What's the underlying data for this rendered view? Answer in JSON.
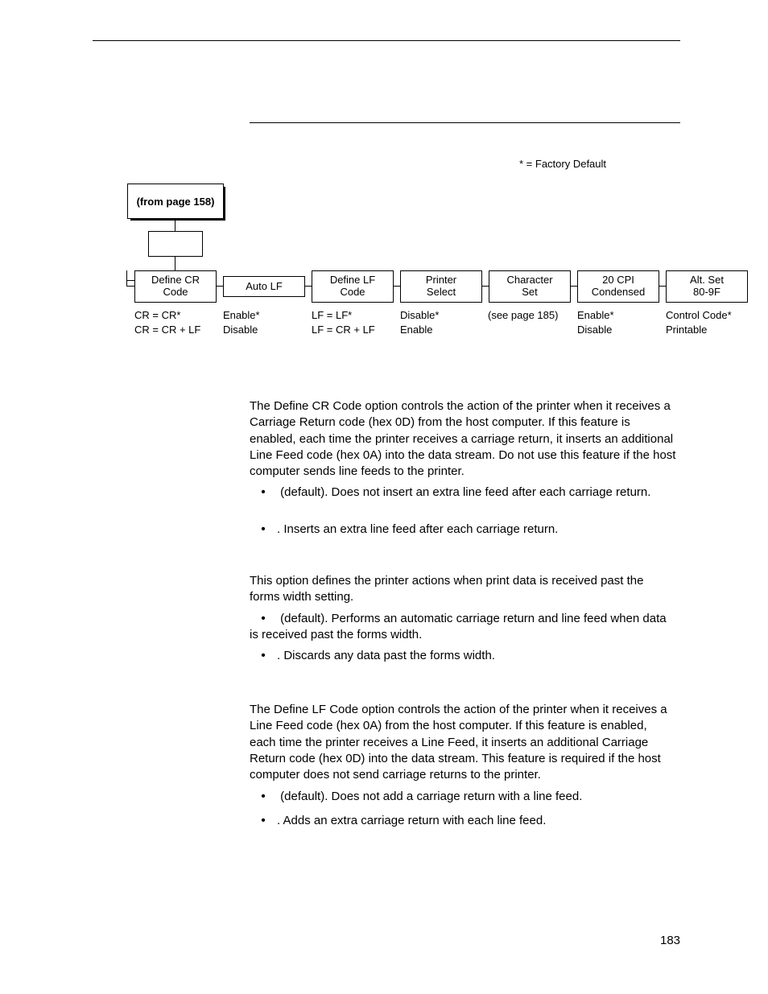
{
  "legend": "* = Factory Default",
  "diagram": {
    "from_page": "(from page 158)",
    "cols": [
      {
        "l1": "Define CR",
        "l2": "Code",
        "o1": "CR = CR*",
        "o2": "CR = CR + LF"
      },
      {
        "l1": "Auto LF",
        "l2": "",
        "o1": "Enable*",
        "o2": "Disable"
      },
      {
        "l1": "Define LF",
        "l2": "Code",
        "o1": "LF = LF*",
        "o2": "LF = CR + LF"
      },
      {
        "l1": "Printer",
        "l2": "Select",
        "o1": "Disable*",
        "o2": "Enable"
      },
      {
        "l1": "Character",
        "l2": "Set",
        "o1": "(see page 185)",
        "o2": ""
      },
      {
        "l1": "20 CPI",
        "l2": "Condensed",
        "o1": "Enable*",
        "o2": "Disable"
      },
      {
        "l1": "Alt. Set",
        "l2": "80-9F",
        "o1": "Control Code*",
        "o2": "Printable"
      }
    ]
  },
  "sections": [
    {
      "para": "The Define CR Code option controls the action of the printer when it receives a Carriage Return code (hex 0D) from the host computer. If this feature is enabled, each time the printer receives a carriage return, it inserts an additional Line Feed code (hex 0A) into the data stream. Do not use this feature if the host computer sends line feeds to the printer.",
      "b1": " (default). Does not insert an extra line feed after each carriage return.",
      "b2": ". Inserts an extra line feed after each carriage return."
    },
    {
      "para": "This option defines the printer actions when print data is received past the forms width setting.",
      "b1": " (default). Performs an automatic carriage return and line feed when data is received past the forms width.",
      "b2": ". Discards any data past the forms width."
    },
    {
      "para": "The Define LF Code option controls the action of the printer when it receives a Line Feed code (hex 0A) from the host computer. If this feature is enabled, each time the printer receives a Line Feed, it inserts an additional Carriage Return code (hex 0D) into the data stream. This feature is required if the host computer does not send carriage returns to the printer.",
      "b1": " (default). Does not add a carriage return with a line feed.",
      "b2": ". Adds an extra carriage return with each line feed."
    }
  ],
  "page_number": "183"
}
